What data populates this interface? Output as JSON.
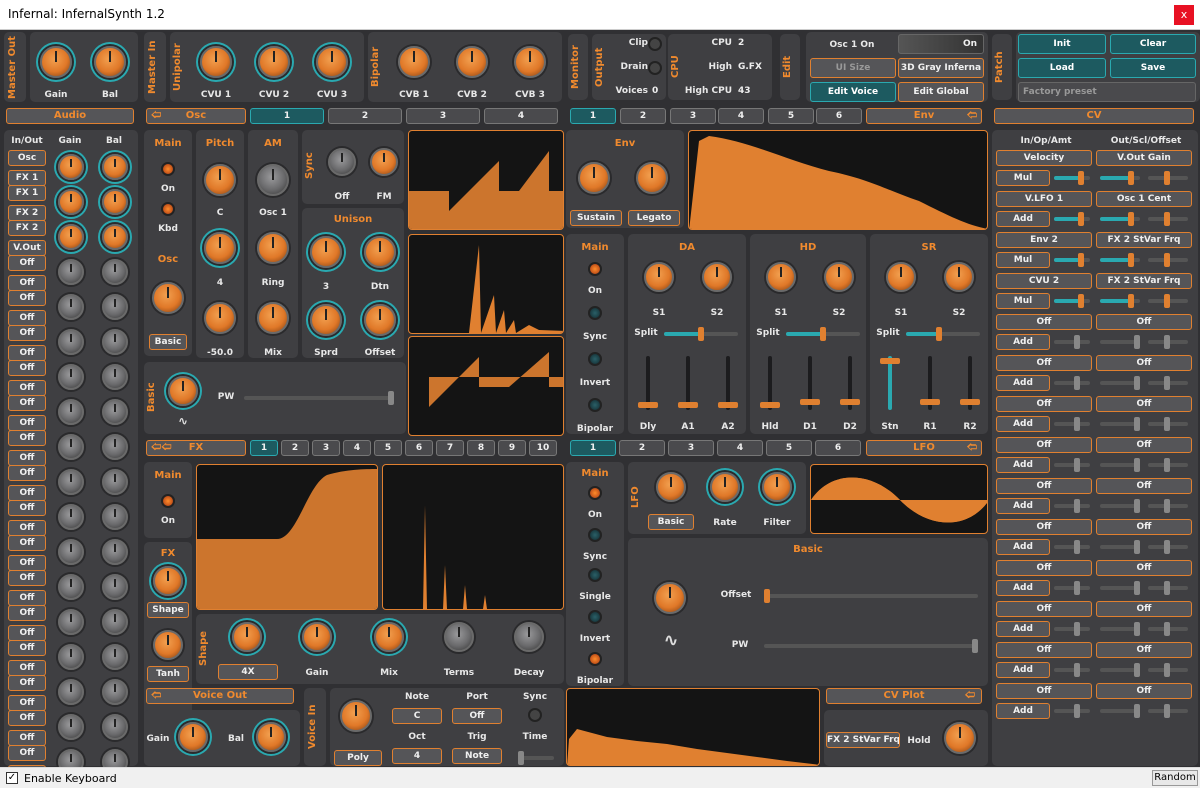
{
  "window": {
    "title": "Infernal: InfernalSynth 1.2",
    "close": "x"
  },
  "footer": {
    "enable_keyboard": "Enable Keyboard",
    "random": "Random"
  },
  "master_out": {
    "label": "Master Out",
    "gain": "Gain",
    "bal": "Bal"
  },
  "master_in": {
    "label": "Master In"
  },
  "unipolar": {
    "label": "Unipolar",
    "knobs": [
      "CVU 1",
      "CVU 2",
      "CVU 3"
    ]
  },
  "bipolar": {
    "label": "Bipolar",
    "knobs": [
      "CVB 1",
      "CVB 2",
      "CVB 3"
    ]
  },
  "monitor": {
    "label": "Monitor",
    "output": "Output",
    "clip": "Clip",
    "drain": "Drain",
    "voices": "Voices",
    "voices_val": "0",
    "cpu_label": "CPU",
    "cpu": "CPU",
    "cpu_val": "2",
    "high": "High",
    "high_val": "G.FX",
    "high_cpu": "High CPU",
    "high_cpu_val": "43"
  },
  "edit": {
    "label": "Edit",
    "osc1on": "Osc 1 On",
    "osc1on_val": "On",
    "ui_size": "UI Size",
    "theme": "3D Gray Inferna",
    "edit_voice": "Edit Voice",
    "edit_global": "Edit Global"
  },
  "patch": {
    "label": "Patch",
    "init": "Init",
    "clear": "Clear",
    "load": "Load",
    "save": "Save",
    "preset": "Factory preset"
  },
  "audio": {
    "tab": "Audio",
    "inout": "In/Out",
    "gain": "Gain",
    "bal": "Bal",
    "rows": [
      [
        "Osc",
        "FX 1"
      ],
      [
        "FX 1",
        "FX 2"
      ],
      [
        "FX 2",
        "V.Out"
      ],
      [
        "Off",
        "Off"
      ],
      [
        "Off",
        "Off"
      ],
      [
        "Off",
        "Off"
      ],
      [
        "Off",
        "Off"
      ],
      [
        "Off",
        "Off"
      ],
      [
        "Off",
        "Off"
      ],
      [
        "Off",
        "Off"
      ],
      [
        "Off",
        "Off"
      ],
      [
        "Off",
        "Off"
      ],
      [
        "Off",
        "Off"
      ],
      [
        "Off",
        "Off"
      ],
      [
        "Off",
        "Off"
      ],
      [
        "Off",
        "Off"
      ],
      [
        "Off",
        "Off"
      ],
      [
        "Off",
        "Off"
      ]
    ]
  },
  "osc": {
    "tab": "Osc",
    "tabs": [
      "1",
      "2",
      "3",
      "4"
    ],
    "main": "Main",
    "on": "On",
    "kbd": "Kbd",
    "osc": "Osc",
    "basic": "Basic",
    "pitch": "Pitch",
    "c": "C",
    "four": "4",
    "neg50": "-50.0",
    "am": "AM",
    "osc1": "Osc 1",
    "ring": "Ring",
    "mix": "Mix",
    "sync": "Sync",
    "off": "Off",
    "fm": "FM",
    "unison": "Unison",
    "three": "3",
    "dtn": "Dtn",
    "sprd": "Sprd",
    "offset": "Offset",
    "basic_label": "Basic",
    "pw": "PW"
  },
  "env": {
    "tab": "Env",
    "tabs": [
      "1",
      "2",
      "3",
      "4",
      "5",
      "6"
    ],
    "env": "Env",
    "sustain": "Sustain",
    "legato": "Legato",
    "main": "Main",
    "on": "On",
    "sync": "Sync",
    "invert": "Invert",
    "bipolar": "Bipolar",
    "da": "DA",
    "hd": "HD",
    "sr": "SR",
    "s1": "S1",
    "s2": "S2",
    "split": "Split",
    "sliders": [
      "Dly",
      "A1",
      "A2",
      "Hld",
      "D1",
      "D2",
      "Stn",
      "R1",
      "R2"
    ]
  },
  "fx": {
    "tab": "FX",
    "tabs": [
      "1",
      "2",
      "3",
      "4",
      "5",
      "6",
      "7",
      "8",
      "9",
      "10"
    ],
    "main": "Main",
    "on": "On",
    "fx": "FX",
    "shape": "Shape",
    "tanh": "Tanh",
    "shape_label": "Shape",
    "four_x": "4X",
    "gain": "Gain",
    "mix": "Mix",
    "terms": "Terms",
    "decay": "Decay"
  },
  "lfo": {
    "tab": "LFO",
    "tabs": [
      "1",
      "2",
      "3",
      "4",
      "5",
      "6"
    ],
    "main": "Main",
    "on": "On",
    "sync": "Sync",
    "single": "Single",
    "invert": "Invert",
    "bipolar": "Bipolar",
    "lfo": "LFO",
    "basic": "Basic",
    "rate": "Rate",
    "filter": "Filter",
    "basic_title": "Basic",
    "offset": "Offset",
    "pw": "PW"
  },
  "voice_out": {
    "tab": "Voice Out",
    "gain": "Gain",
    "bal": "Bal"
  },
  "voice_in": {
    "label": "Voice In",
    "note": "Note",
    "note_val": "C",
    "port": "Port",
    "port_val": "Off",
    "sync": "Sync",
    "oct": "Oct",
    "oct_val": "4",
    "trig": "Trig",
    "trig_val": "Note",
    "time": "Time",
    "poly": "Poly"
  },
  "cv_plot": {
    "tab": "CV Plot",
    "target": "FX 2 StVar Frq",
    "hold": "Hold"
  },
  "cv": {
    "tab": "CV",
    "col1": "In/Op/Amt",
    "col2": "Out/Scl/Offset",
    "rows": [
      [
        "Velocity",
        "V.Out Gain",
        "Mul"
      ],
      [
        "V.LFO 1",
        "Osc 1 Cent",
        "Add"
      ],
      [
        "Env 2",
        "FX 2 StVar Frq",
        "Mul"
      ],
      [
        "CVU 2",
        "FX 2 StVar Frq",
        "Mul"
      ],
      [
        "Off",
        "Off",
        "Add"
      ],
      [
        "Off",
        "Off",
        "Add"
      ],
      [
        "Off",
        "Off",
        "Add"
      ],
      [
        "Off",
        "Off",
        "Add"
      ],
      [
        "Off",
        "Off",
        "Add"
      ],
      [
        "Off",
        "Off",
        "Add"
      ],
      [
        "Off",
        "Off",
        "Add"
      ],
      [
        "Off",
        "Off",
        "Add"
      ],
      [
        "Off",
        "Off",
        "Add"
      ],
      [
        "Off",
        "Off",
        "Add"
      ]
    ]
  },
  "colors": {
    "accent": "#e08030",
    "teal": "#2aa9b0",
    "panel": "#3f3f42",
    "bg": "#303033"
  }
}
